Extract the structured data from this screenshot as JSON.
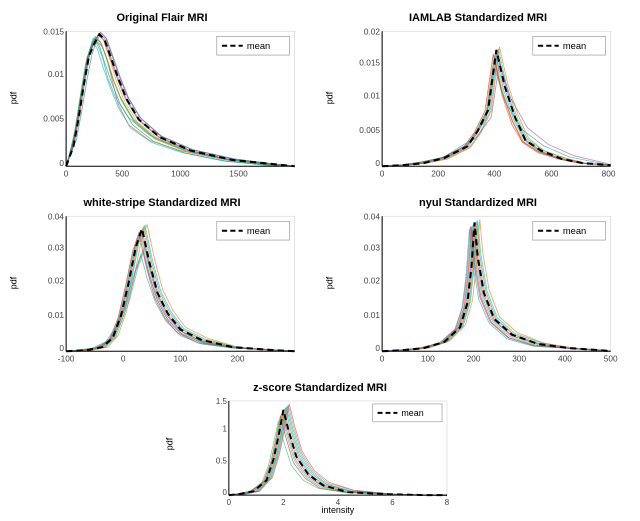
{
  "plots": [
    {
      "id": "original-flair",
      "title": "Original Flair MRI",
      "y_label": "pdf",
      "x_ticks": [
        "0",
        "500",
        "1000",
        "1500"
      ],
      "y_ticks": [
        "0",
        "0.005",
        "0.01",
        "0.015"
      ],
      "legend_label": "mean",
      "position": "top-left"
    },
    {
      "id": "iamlab",
      "title": "IAMLAB Standardized MRI",
      "y_label": "pdf",
      "x_ticks": [
        "0",
        "200",
        "400",
        "600",
        "800"
      ],
      "y_ticks": [
        "0",
        "0.005",
        "0.01",
        "0.015",
        "0.02"
      ],
      "legend_label": "mean",
      "position": "top-right"
    },
    {
      "id": "white-stripe",
      "title": "white-stripe Standardized MRI",
      "y_label": "pdf",
      "x_ticks": [
        "-100",
        "0",
        "100",
        "200"
      ],
      "y_ticks": [
        "0",
        "0.01",
        "0.02",
        "0.03",
        "0.04"
      ],
      "legend_label": "mean",
      "position": "mid-left"
    },
    {
      "id": "nyul",
      "title": "nyul Standardized MRI",
      "y_label": "pdf",
      "x_ticks": [
        "0",
        "100",
        "200",
        "300",
        "400",
        "500"
      ],
      "y_ticks": [
        "0",
        "0.01",
        "0.02",
        "0.03",
        "0.04"
      ],
      "legend_label": "mean",
      "position": "mid-right"
    },
    {
      "id": "zscore",
      "title": "z-score Standardized MRI",
      "y_label": "pdf",
      "x_label": "intensity",
      "x_ticks": [
        "0",
        "2",
        "4",
        "6",
        "8"
      ],
      "y_ticks": [
        "0",
        "0.5",
        "1",
        "1.5"
      ],
      "legend_label": "mean",
      "position": "bottom-center"
    }
  ],
  "colors": {
    "accent": "#000000",
    "background": "#ffffff",
    "mean_line": "#000000"
  }
}
